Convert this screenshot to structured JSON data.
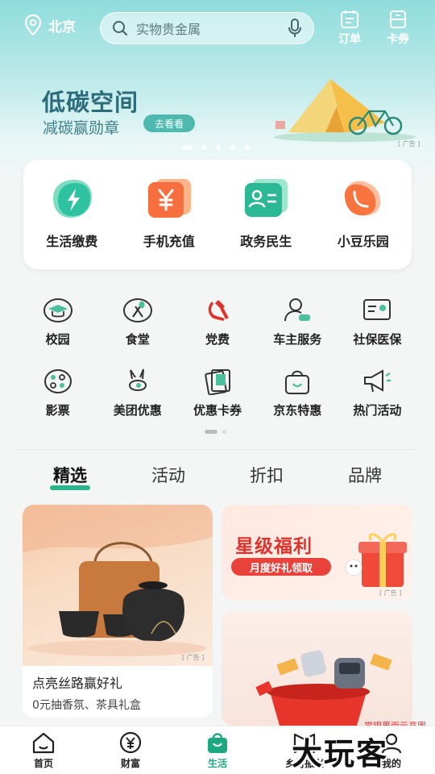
{
  "header": {
    "location": "北京",
    "search_placeholder": "实物贵金属",
    "orders_label": "订单",
    "cards_label": "卡券"
  },
  "banner": {
    "title": "低碳空间",
    "subtitle": "减碳赢勋章",
    "button": "去看看",
    "ad_tag": "[ 广告 ]"
  },
  "main_services": [
    {
      "label": "生活缴费",
      "icon": "lightning-drop-icon"
    },
    {
      "label": "手机充值",
      "icon": "yuan-card-icon"
    },
    {
      "label": "政务民生",
      "icon": "id-card-icon"
    },
    {
      "label": "小豆乐园",
      "icon": "bean-icon"
    }
  ],
  "grid_row1": [
    {
      "label": "校园",
      "icon": "graduation-cap-icon"
    },
    {
      "label": "食堂",
      "icon": "fork-spoon-icon"
    },
    {
      "label": "党费",
      "icon": "party-emblem-icon"
    },
    {
      "label": "车主服务",
      "icon": "car-owner-icon"
    },
    {
      "label": "社保医保",
      "icon": "insurance-card-icon"
    }
  ],
  "grid_row2": [
    {
      "label": "影票",
      "icon": "film-reel-icon"
    },
    {
      "label": "美团优惠",
      "icon": "rabbit-icon"
    },
    {
      "label": "优惠卡券",
      "icon": "coupon-icon"
    },
    {
      "label": "京东特惠",
      "icon": "shopping-bag-icon"
    },
    {
      "label": "热门活动",
      "icon": "megaphone-icon"
    }
  ],
  "tabs": [
    "精选",
    "活动",
    "折扣",
    "品牌"
  ],
  "cards": {
    "left_title": "点亮丝路赢好礼",
    "left_sub": "0元抽香氛、茶具礼盒",
    "left_ad": "[ 广告 ]",
    "star_title": "星级福利",
    "star_sub": "月度好礼领取",
    "star_ad": "[ 广告 ]"
  },
  "watermark": {
    "small": "掌银界面示意图",
    "big": "大玩客"
  },
  "bottom_nav": [
    {
      "label": "首页",
      "icon": "home-icon"
    },
    {
      "label": "财富",
      "icon": "yuan-circle-icon"
    },
    {
      "label": "生活",
      "icon": "life-bag-icon"
    },
    {
      "label": "乡村振兴",
      "icon": "village-icon"
    },
    {
      "label": "我的",
      "icon": "profile-icon"
    }
  ],
  "colors": {
    "accent": "#1da882",
    "brand_red": "#e0322c"
  }
}
